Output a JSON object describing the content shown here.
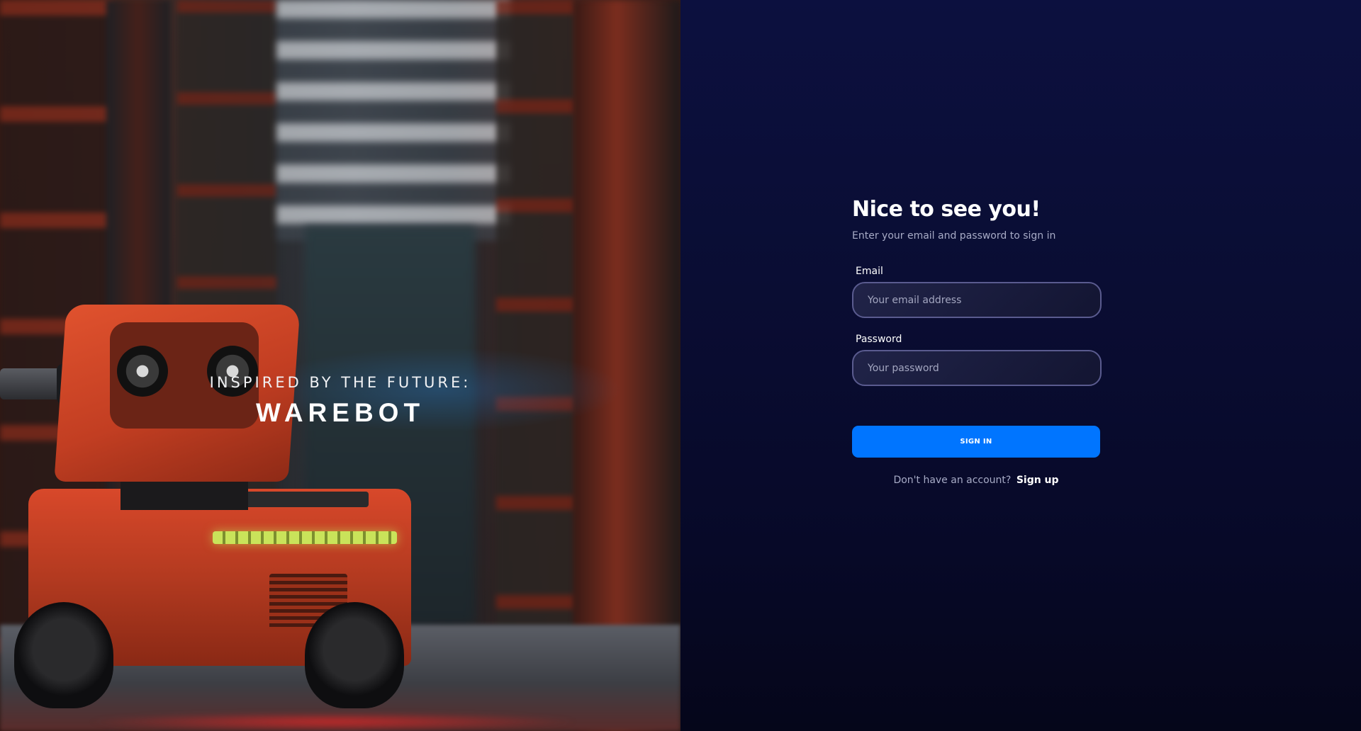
{
  "hero": {
    "tagline": "INSPIRED BY THE FUTURE:",
    "brand": "WAREBOT"
  },
  "form": {
    "title": "Nice to see you!",
    "subtitle": "Enter your email and password to sign in",
    "email": {
      "label": "Email",
      "placeholder": "Your email address",
      "value": ""
    },
    "password": {
      "label": "Password",
      "placeholder": "Your password",
      "value": ""
    },
    "submit_label": "SIGN IN",
    "signup_prompt": "Don't have an account?",
    "signup_link": "Sign up"
  },
  "colors": {
    "accent": "#0075ff",
    "background": "#0a0d33",
    "input_border": "#5a5b8f",
    "muted_text": "#a7abc6"
  }
}
